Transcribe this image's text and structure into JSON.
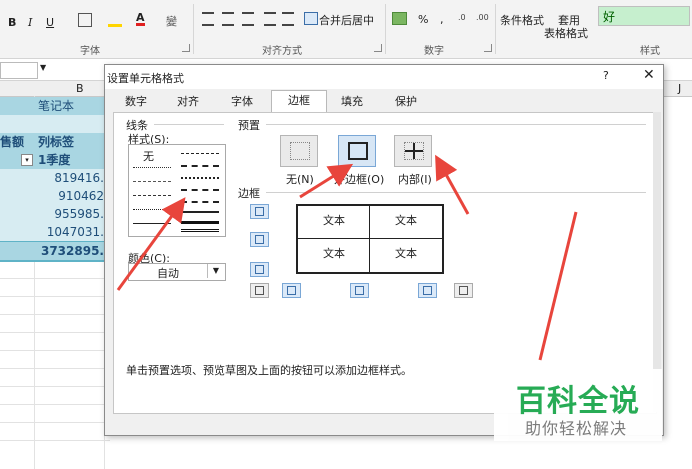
{
  "ribbon": {
    "font_group_label": "字体",
    "align_group_label": "对齐方式",
    "number_group_label": "数字",
    "styles_group_label": "样式",
    "merge_center": "合并后居中",
    "percent": "%",
    "comma": ",",
    "conditional_format": "条件格式",
    "table_format_line1": "套用",
    "table_format_line2": "表格格式",
    "good_style": "好",
    "wubi": "變",
    "bold": "B",
    "italic": "I",
    "underline": "U"
  },
  "sheet": {
    "column_b": "B",
    "column_j": "J",
    "cells": {
      "b_title": "笔记本",
      "sales_label": "售额",
      "column_label": "列标签",
      "quarter": "1季度",
      "v1": "819416.",
      "v2": "910462",
      "v3": "955985.",
      "v4": "1047031.",
      "total": "3732895."
    }
  },
  "dialog": {
    "title": "设置单元格格式",
    "help": "?",
    "close": "✕",
    "tabs": [
      "数字",
      "对齐",
      "字体",
      "边框",
      "填充",
      "保护"
    ],
    "active_tab": "边框",
    "line_section": "线条",
    "style_label": "样式(S):",
    "style_none": "无",
    "color_label": "颜色(C):",
    "color_value": "自动",
    "preset_section": "预置",
    "preset_none": "无(N)",
    "preset_outline": "外边框(O)",
    "preset_inside": "内部(I)",
    "border_section": "边框",
    "preview_text": [
      "文本",
      "文本",
      "文本",
      "文本"
    ],
    "hint": "单击预置选项、预览草图及上面的按钮可以添加边框样式。"
  },
  "watermark": {
    "title": "百科全说",
    "subtitle": "助你轻松解决"
  },
  "colors": {
    "accent_teal": "#5fb3c7",
    "row_teal_light": "#a9d6e2",
    "arrow_red": "#e8453c",
    "good_bg": "#c6efce",
    "good_text": "#006100",
    "watermark_green": "#1fa84f"
  }
}
